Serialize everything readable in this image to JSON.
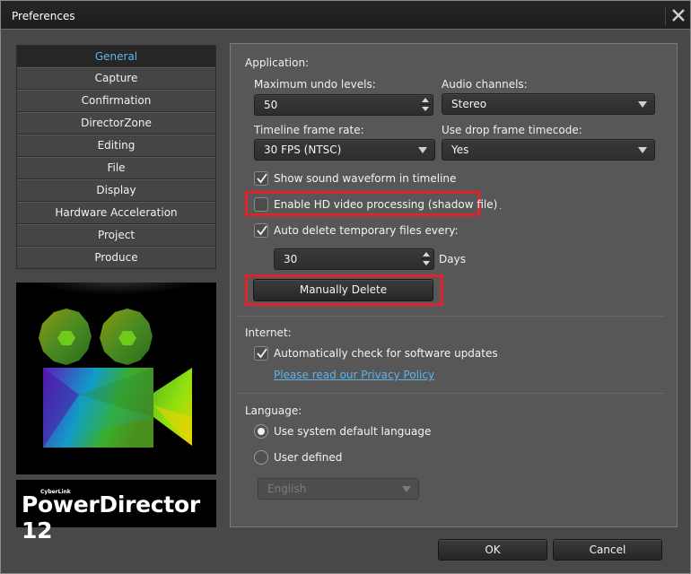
{
  "window": {
    "title": "Preferences",
    "close_icon": "close-icon"
  },
  "sidebar": {
    "items": [
      {
        "label": "General",
        "active": true
      },
      {
        "label": "Capture",
        "active": false
      },
      {
        "label": "Confirmation",
        "active": false
      },
      {
        "label": "DirectorZone",
        "active": false
      },
      {
        "label": "Editing",
        "active": false
      },
      {
        "label": "File",
        "active": false
      },
      {
        "label": "Display",
        "active": false
      },
      {
        "label": "Hardware Acceleration",
        "active": false
      },
      {
        "label": "Project",
        "active": false
      },
      {
        "label": "Produce",
        "active": false
      }
    ],
    "brand_small": "CyberLink",
    "brand_name": "PowerDirector 12"
  },
  "application": {
    "heading": "Application:",
    "undo_label": "Maximum undo levels:",
    "undo_value": "50",
    "audio_label": "Audio channels:",
    "audio_value": "Stereo",
    "framerate_label": "Timeline frame rate:",
    "framerate_value": "30 FPS (NTSC)",
    "dropframe_label": "Use drop frame timecode:",
    "dropframe_value": "Yes",
    "waveform_label": "Show sound waveform in timeline",
    "waveform_checked": true,
    "hd_label": "Enable HD video processing (shadow file)",
    "hd_checked": false,
    "autodelete_label": "Auto delete temporary files every:",
    "autodelete_checked": true,
    "days_value": "30",
    "days_unit": "Days",
    "manual_delete_label": "Manually Delete"
  },
  "internet": {
    "heading": "Internet:",
    "updates_label": "Automatically check for software updates",
    "updates_checked": true,
    "privacy_link": "Please read our Privacy Policy"
  },
  "language": {
    "heading": "Language:",
    "system_default_label": "Use system default language",
    "user_defined_label": "User defined",
    "selected": "system_default",
    "language_value": "English"
  },
  "footer": {
    "ok_label": "OK",
    "cancel_label": "Cancel"
  },
  "colors": {
    "accent": "#5fb6ec",
    "highlight": "#e3212b",
    "link": "#5cb4ee"
  }
}
